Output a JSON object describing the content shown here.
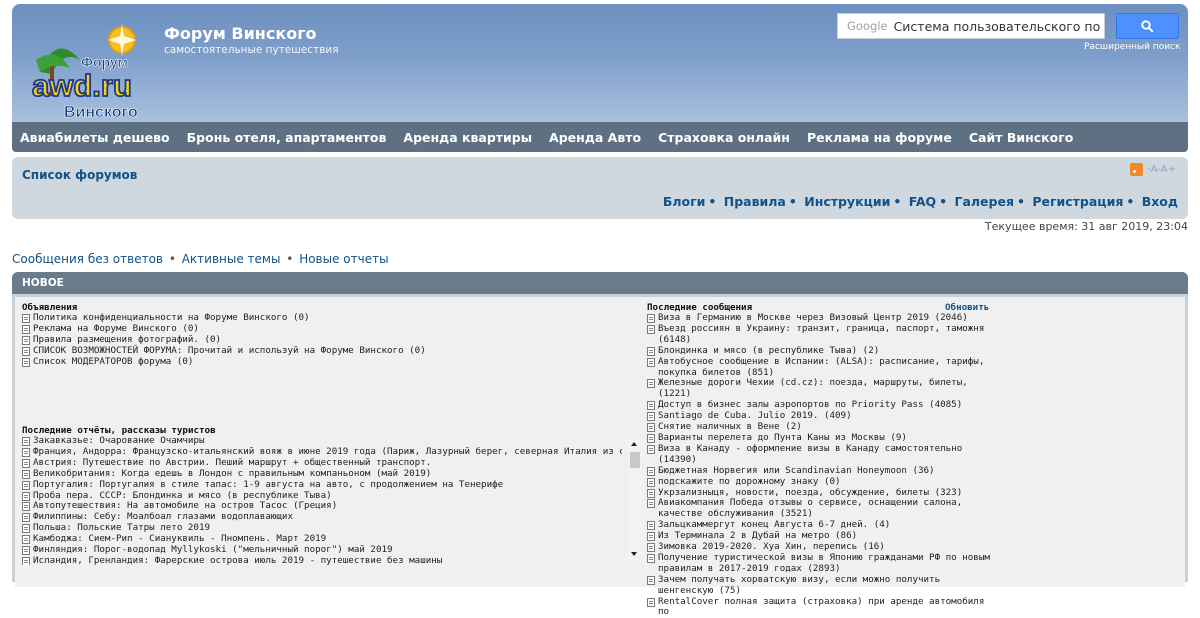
{
  "header": {
    "logo_line1": "Форум",
    "logo_line2": "awd.ru",
    "logo_line3": "Винского",
    "title": "Форум Винского",
    "description": "самостоятельные путешествия",
    "search_brand": "Google",
    "search_value": "Система пользовательского по",
    "advanced_search": "Расширенный поиск"
  },
  "nav": [
    "Авиабилеты дешево",
    "Бронь отеля, апартаментов",
    "Аренда квартиры",
    "Аренда Авто",
    "Страховка онлайн",
    "Реклама на форуме",
    "Сайт Винского"
  ],
  "crumbs": {
    "forum_list": "Список форумов",
    "font_size": "-A-A+",
    "quicklinks": [
      "Блоги",
      "Правила",
      "Инструкции",
      "FAQ",
      "Галерея",
      "Регистрация",
      "Вход"
    ]
  },
  "current_time": "Текущее время: 31 авг 2019, 23:04",
  "search_links": [
    "Сообщения без ответов",
    "Активные темы",
    "Новые отчеты"
  ],
  "panel": {
    "title": "НОВОЕ",
    "announcements_title": "Объявления",
    "announcements": [
      "Политика конфиденциальности на Форуме Винского (0)",
      "Реклама на Форуме Винского (0)",
      "Правила размещения фотографий. (0)",
      "СПИСОК ВОЗМОЖНОСТЕЙ ФОРУМА: Прочитай и используй на Форуме Винского (0)",
      "Список МОДЕРАТОРОВ форума (0)"
    ],
    "reports_title": "Последние отчёты, рассказы туристов",
    "reports": [
      "Закавказье: Очарование Очамчиры",
      "Франция, Андорра: Французско-итальянский вояж в июне 2019 года (Париж, Лазурный берег, северная Италия из о/т)",
      "Австрия: Путешествие по Австрии. Пеший маршрут + общественный транспорт.",
      "Великобритания: Когда едешь в Лондон с правильным компаньоном (май 2019)",
      "Португалия: Португалия в стиле тапас: 1-9 августа на авто, с продолжением на Тенерифе",
      "Проба пера. СССР: Блондинка и мясо (в республике Тыва)",
      "Автопутешествия: На автомобиле на остров Тасос (Греция)",
      "Филиппины: Себу: Моалбоал глазами водоплавающих",
      "Польша: Польские Татры лето 2019",
      "Камбоджа: Сием-Рип - Сиануквиль - Пномпень. Март 2019",
      "Финляндия: Порог-водопад Myllykoski (\"мельничный порог\") май 2019",
      "Исландия, Гренландия: Фарерские острова июль 2019 - путешествие без машины"
    ],
    "recent_title": "Последние сообщения",
    "refresh": "Обновить",
    "recent": [
      "Виза в Германию в Москве через Визовый Центр 2019 (2046)",
      "Въезд россиян в Украину: транзит, граница, паспорт, таможня (6148)",
      "Блондинка и мясо (в республике Тыва) (2)",
      "Автобусное сообщение в Испании: (ALSA): расписание, тарифы, покупка билетов (851)",
      "Железные дороги Чехии (cd.cz): поезда, маршруты, билеты, (1221)",
      "Доступ в бизнес залы аэропортов по Priority Pass (4085)",
      "Santiago de Cuba. Julio 2019. (409)",
      "Снятие наличных в Вене (2)",
      "Варианты перелета до Пунта Каны из Москвы (9)",
      "Виза в Канаду - оформление визы в Канаду самостоятельно (14390)",
      "Бюджетная Норвегия или Scandinavian Honeymoon (36)",
      "подскажите по дорожному знаку (0)",
      "Укрзализныця, новости, поезда, обсуждение, билеты (323)",
      "Авиакомпания Победа отзывы о сервисе, оснащении салона, качестве обслуживания (3521)",
      "Зальцкаммергут конец Августа 6-7 дней. (4)",
      "Из Терминала 2 в Дубай на метро (86)",
      "Зимовка 2019-2020. Хуа Хин, перепись (16)",
      "Получение туристической визы в Японию гражданами РФ по новым правилам в 2017-2019 годах (2893)",
      "Зачем получать хорватскую визу, если можно получить шенгенскую (75)",
      "RentalCover полная защита (страховка) при аренде автомобиля по"
    ]
  }
}
